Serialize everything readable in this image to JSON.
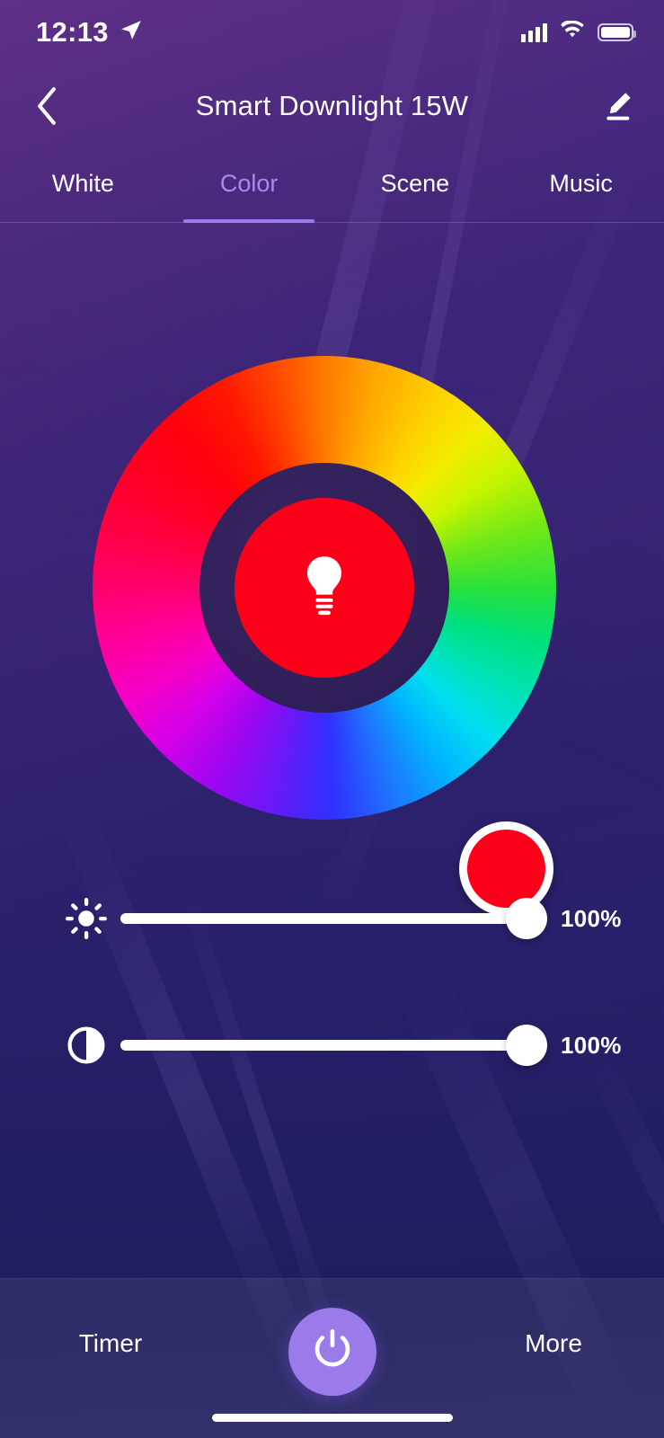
{
  "status_bar": {
    "time": "12:13",
    "location_icon": "location-arrow-icon",
    "cellular_icon": "cellular-signal-icon",
    "wifi_icon": "wifi-icon",
    "battery_icon": "battery-full-icon"
  },
  "nav": {
    "back_icon": "chevron-left-icon",
    "title": "Smart Downlight 15W",
    "edit_icon": "pencil-edit-icon"
  },
  "tabs": {
    "items": [
      {
        "label": "White",
        "active": false
      },
      {
        "label": "Color",
        "active": true
      },
      {
        "label": "Scene",
        "active": false
      },
      {
        "label": "Music",
        "active": false
      }
    ],
    "active_color": "#a58bf0",
    "indicator_color": "#9a7ced"
  },
  "color_wheel": {
    "selected_color": "#FB0019",
    "bulb_icon": "light-bulb-icon",
    "handle_icon": "color-handle",
    "handle_angle_deg": 0
  },
  "sliders": [
    {
      "name": "brightness",
      "icon": "brightness-sun-icon",
      "value": 100,
      "value_label": "100%"
    },
    {
      "name": "saturation",
      "icon": "saturation-contrast-icon",
      "value": 100,
      "value_label": "100%"
    }
  ],
  "bottom_bar": {
    "timer_label": "Timer",
    "power_icon": "power-icon",
    "power_color": "#9B7BEA",
    "more_label": "More"
  }
}
